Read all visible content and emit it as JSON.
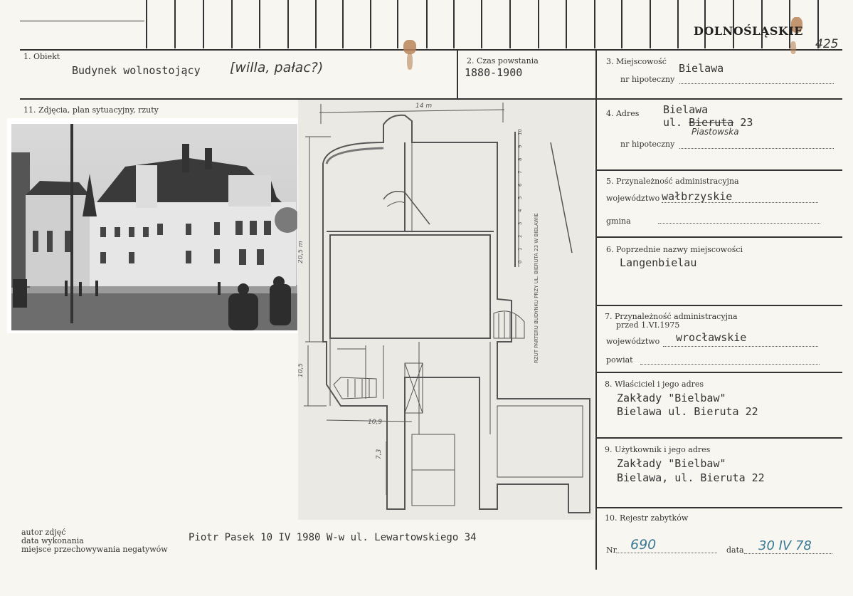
{
  "region_stamp": "DOLNOŚLĄSKIE",
  "corner_number": "425",
  "field1": {
    "label": "1. Obiekt",
    "value": "Budynek wolnostojący",
    "handwritten": "[willa, pałac?)"
  },
  "field2": {
    "label": "2. Czas powstania",
    "value": "1880-1900"
  },
  "field3": {
    "label": "3. Miejscowość",
    "value": "Bielawa",
    "sub_label": "nr hipoteczny"
  },
  "field4": {
    "label": "4. Adres",
    "line1": "Bielawa",
    "line2_prefix": "ul.",
    "street_struck": "Bieruta",
    "number": "23",
    "handwritten_street": "Piastowska",
    "sub_label": "nr hipoteczny"
  },
  "field5": {
    "label": "5. Przynależność administracyjna",
    "woj_label": "województwo",
    "woj_value": "wałbrzyskie",
    "gmina_label": "gmina"
  },
  "field6": {
    "label": "6. Poprzednie nazwy miejscowości",
    "value": "Langenbielau"
  },
  "field7": {
    "label_line1": "7. Przynależność administracyjna",
    "label_line2": "przed 1.VI.1975",
    "woj_label": "województwo",
    "woj_value": "wrocławskie",
    "powiat_label": "powiat"
  },
  "field8": {
    "label": "8. Właściciel i jego adres",
    "line1": "Zakłady \"Bielbaw\"",
    "line2": "Bielawa ul. Bieruta 22"
  },
  "field9": {
    "label": "9. Użytkownik i jego adres",
    "line1": "Zakłady \"Bielbaw\"",
    "line2": "Bielawa, ul. Bieruta 22"
  },
  "field10": {
    "label": "10. Rejestr zabytków",
    "nr_label": "Nr",
    "nr_value": "690",
    "data_label": "data",
    "data_value": "30 IV 78"
  },
  "field11": {
    "label": "11. Zdjęcia, plan sytuacyjny, rzuty"
  },
  "plan": {
    "dim_top": "14 m",
    "dim_left": "20,5 m",
    "dim_left2": "10,5",
    "dim_bottom": "10,9",
    "dim_bottom2": "7,3",
    "vertical_caption": "RZUT PARTERU BUDYNKU PRZY UL. BIERUTA 23 W BIELAWIE",
    "scale_labels": [
      "0",
      "1",
      "2",
      "3",
      "4",
      "5",
      "6",
      "7",
      "8",
      "9",
      "10"
    ]
  },
  "footer": {
    "labels": [
      "autor zdjęć",
      "data wykonania",
      "miejsce przechowywania negatywów"
    ],
    "value": "Piotr Pasek  10 IV 1980 W-w ul. Lewartowskiego 34"
  }
}
